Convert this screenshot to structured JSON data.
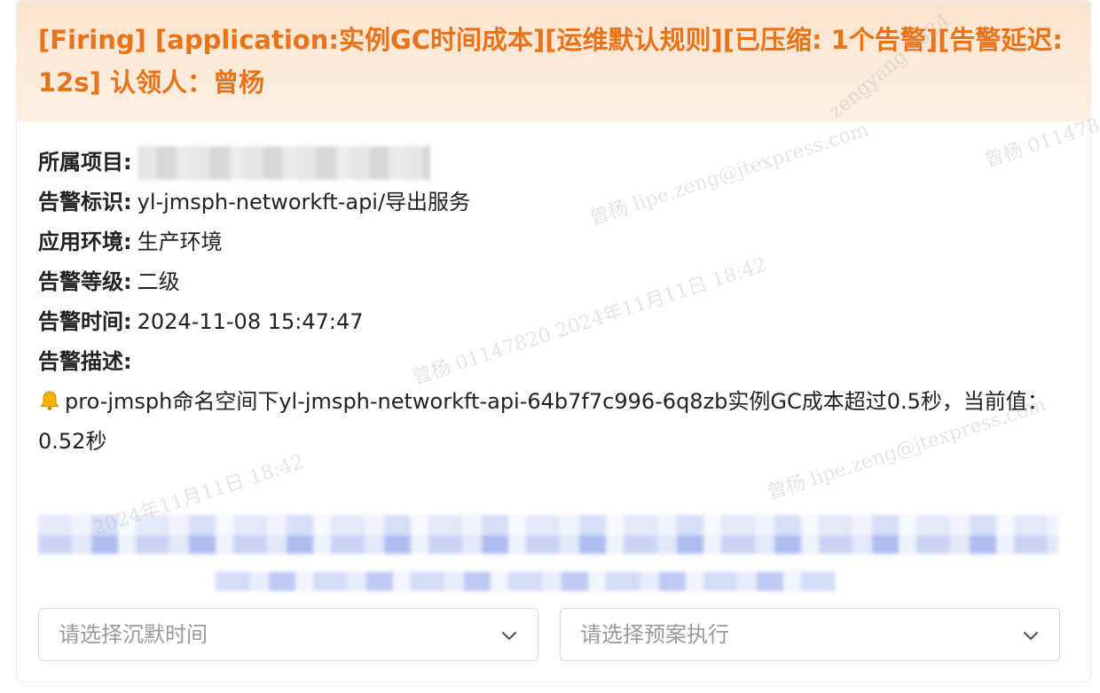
{
  "alert": {
    "title": "[Firing] [application:实例GC时间成本][运维默认规则][已压缩: 1个告警][告警延迟: 12s]   认领人：曾杨",
    "fields": [
      {
        "label": "所属项目:",
        "value": ""
      },
      {
        "label": "告警标识:",
        "value": "yl-jmsph-networkft-api/导出服务"
      },
      {
        "label": "应用环境:",
        "value": "生产环境"
      },
      {
        "label": "告警等级:",
        "value": "二级"
      },
      {
        "label": "告警时间:",
        "value": "2024-11-08 15:47:47"
      },
      {
        "label": "告警描述:",
        "value": ""
      }
    ],
    "description": "pro-jmsph命名空间下yl-jmsph-networkft-api-64b7f7c996-6q8zb实例GC成本超过0.5秒，当前值：0.52秒",
    "bell_icon": "bell-icon"
  },
  "selects": {
    "silence_placeholder": "请选择沉默时间",
    "plan_placeholder": "请选择预案执行"
  },
  "watermarks": [
    "曾杨 lipe.zeng@jtexpress.com",
    "曾杨 01147820 2024年11月11日 18:42",
    "zengyang 2024",
    "曾杨 011478",
    "曾杨 lipe.zeng@jtexpress.com",
    "2024年11月11日 18:42"
  ],
  "colors": {
    "title": "#e8731a",
    "header_bg": "#fbe3cc",
    "link": "#3b64e0"
  }
}
